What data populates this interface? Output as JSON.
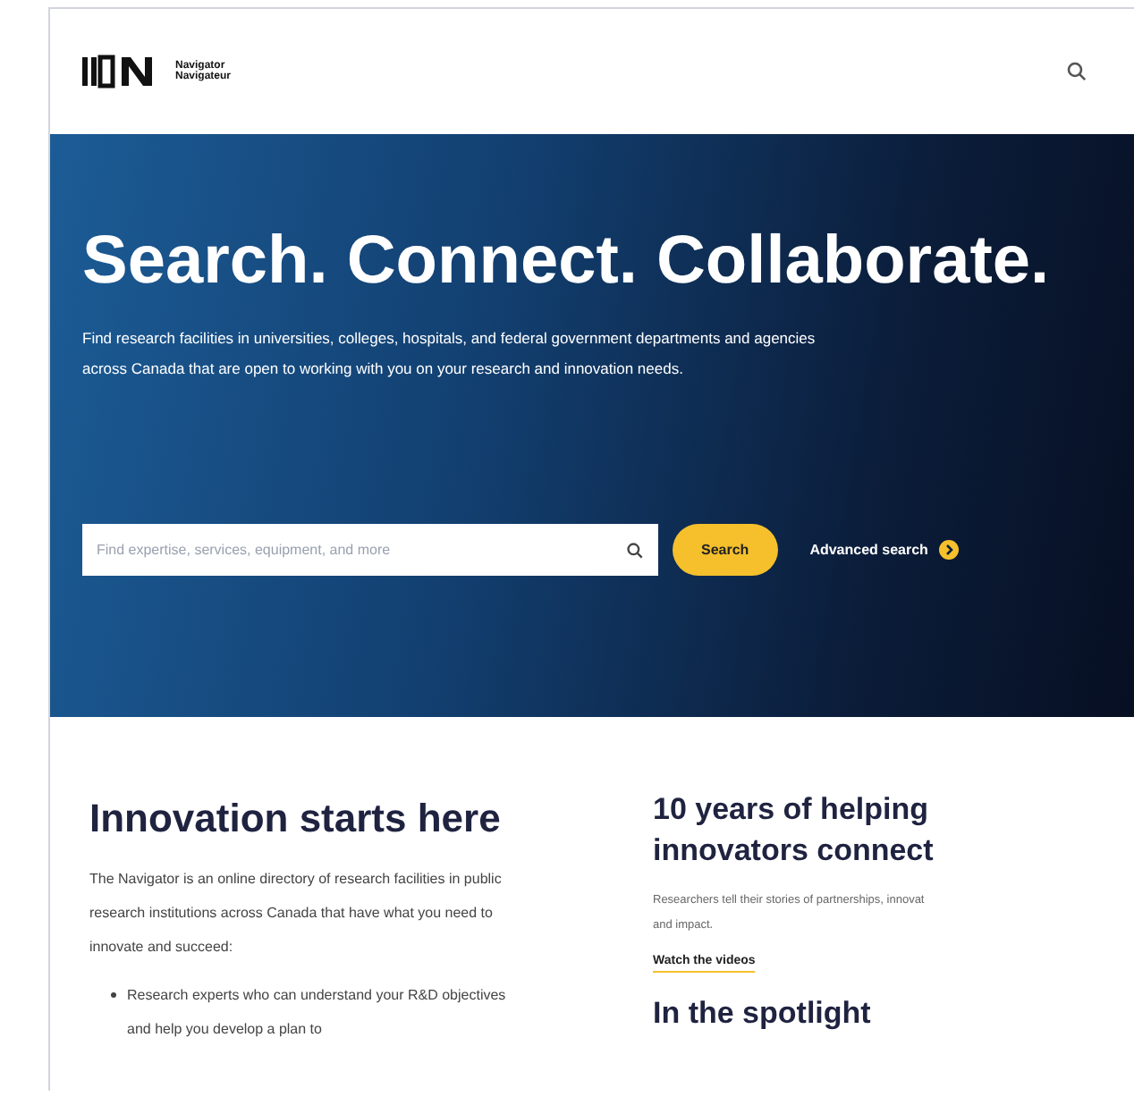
{
  "header": {
    "logo": {
      "line_1": "Navigator",
      "line_2": "Navigateur"
    }
  },
  "hero": {
    "title": "Search. Connect. Collaborate.",
    "text": "Find research facilities in universities, colleges, hospitals, and federal government departments and agencies across Canada that are open to working with you on your research and innovation needs.",
    "search": {
      "placeholder": "Find expertise, services, equipment, and more"
    },
    "search_button": "Search",
    "advanced_link": "Advanced search"
  },
  "intro": {
    "title": "Innovation starts here",
    "text": "The Navigator is an online directory of research facilities in public research institutions across Canada that have what you need to innovate and succeed:",
    "bullets": [
      "Research experts who can understand your R&D objectives and help you develop a plan to"
    ]
  },
  "side": {
    "title": "10 years of helping innovators connect",
    "text_line_1": "Researchers tell their stories of partnerships, innovat",
    "text_line_2": "and impact.",
    "link": "Watch the videos",
    "spotlight_title": "In the spotlight"
  }
}
